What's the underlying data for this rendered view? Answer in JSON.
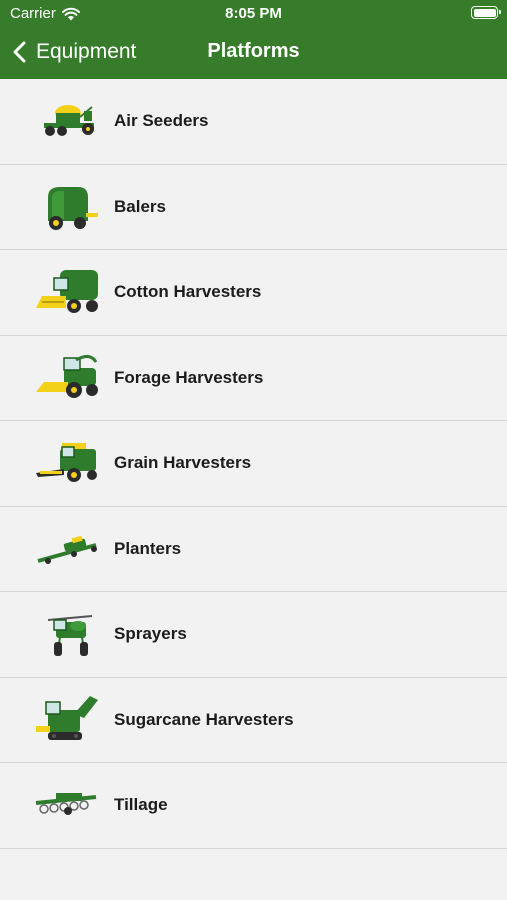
{
  "status_bar": {
    "carrier": "Carrier",
    "time": "8:05 PM",
    "battery_level": 1.0
  },
  "nav": {
    "back_label": "Equipment",
    "title": "Platforms",
    "bar_color": "#367c2b"
  },
  "colors": {
    "jd_green": "#2f7d2c",
    "jd_yellow": "#f3d119",
    "tire": "#2b2b2b"
  },
  "platforms": [
    {
      "label": "Air Seeders",
      "icon": "air-seeder-icon"
    },
    {
      "label": "Balers",
      "icon": "baler-icon"
    },
    {
      "label": "Cotton Harvesters",
      "icon": "cotton-harvester-icon"
    },
    {
      "label": "Forage Harvesters",
      "icon": "forage-harvester-icon"
    },
    {
      "label": "Grain Harvesters",
      "icon": "grain-harvester-icon"
    },
    {
      "label": "Planters",
      "icon": "planter-icon"
    },
    {
      "label": "Sprayers",
      "icon": "sprayer-icon"
    },
    {
      "label": "Sugarcane Harvesters",
      "icon": "sugarcane-harvester-icon"
    },
    {
      "label": "Tillage",
      "icon": "tillage-icon"
    }
  ]
}
